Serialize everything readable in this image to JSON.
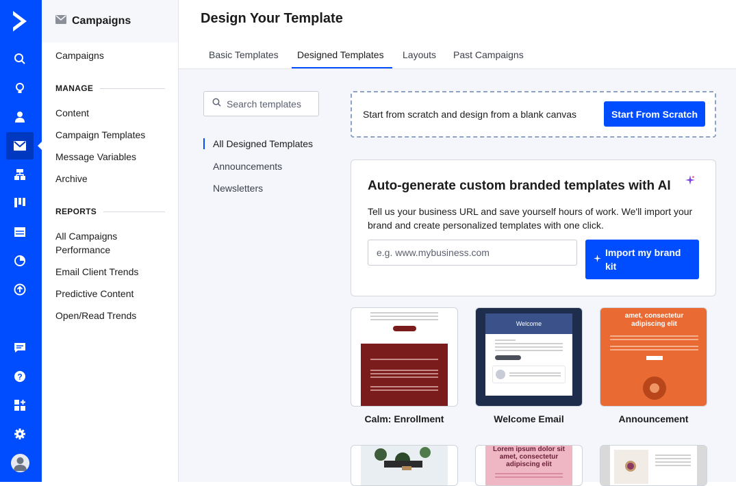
{
  "app": {
    "rail_icons": [
      "logo-icon",
      "search-icon",
      "lightbulb-icon",
      "contacts-icon",
      "mail-icon",
      "automation-icon",
      "pipeline-icon",
      "website-icon",
      "reports-icon",
      "upload-icon",
      "conversations-icon",
      "help-icon",
      "apps-icon",
      "settings-icon",
      "avatar-icon"
    ]
  },
  "sidebar": {
    "title": "Campaigns",
    "top_link": "Campaigns",
    "manage_heading": "MANAGE",
    "manage_items": [
      "Content",
      "Campaign Templates",
      "Message Variables",
      "Archive"
    ],
    "reports_heading": "REPORTS",
    "reports_items": [
      "All Campaigns Performance",
      "Email Client Trends",
      "Predictive Content",
      "Open/Read Trends"
    ]
  },
  "header": {
    "title": "Design Your Template",
    "tabs": [
      "Basic Templates",
      "Designed Templates",
      "Layouts",
      "Past Campaigns"
    ],
    "active_tab": "Designed Templates"
  },
  "filters": {
    "search_placeholder": "Search templates",
    "items": [
      "All Designed Templates",
      "Announcements",
      "Newsletters"
    ],
    "active": "All Designed Templates"
  },
  "scratch": {
    "text": "Start from scratch and design from a blank canvas",
    "button": "Start From Scratch"
  },
  "ai_card": {
    "title": "Auto-generate custom branded templates with AI",
    "description": "Tell us your business URL and save yourself hours of work. We'll import your brand and create personalized templates with one click.",
    "url_placeholder": "e.g. www.mybusiness.com",
    "button_line1": "Import my brand",
    "button_line2": "kit"
  },
  "templates": [
    {
      "name": "Calm: Enrollment"
    },
    {
      "name": "Welcome Email",
      "preview_heading": "Welcome"
    },
    {
      "name": "Announcement",
      "preview_heading": "amet, consectetur adipiscing elit"
    },
    {
      "name": ""
    },
    {
      "name": "",
      "preview_heading": "Lorem ipsum dolor sit amet, consectetur adipiscing elit"
    },
    {
      "name": ""
    }
  ],
  "colors": {
    "brand": "#004cff",
    "rail": "#004cff",
    "content_bg": "#f4f6fb"
  }
}
